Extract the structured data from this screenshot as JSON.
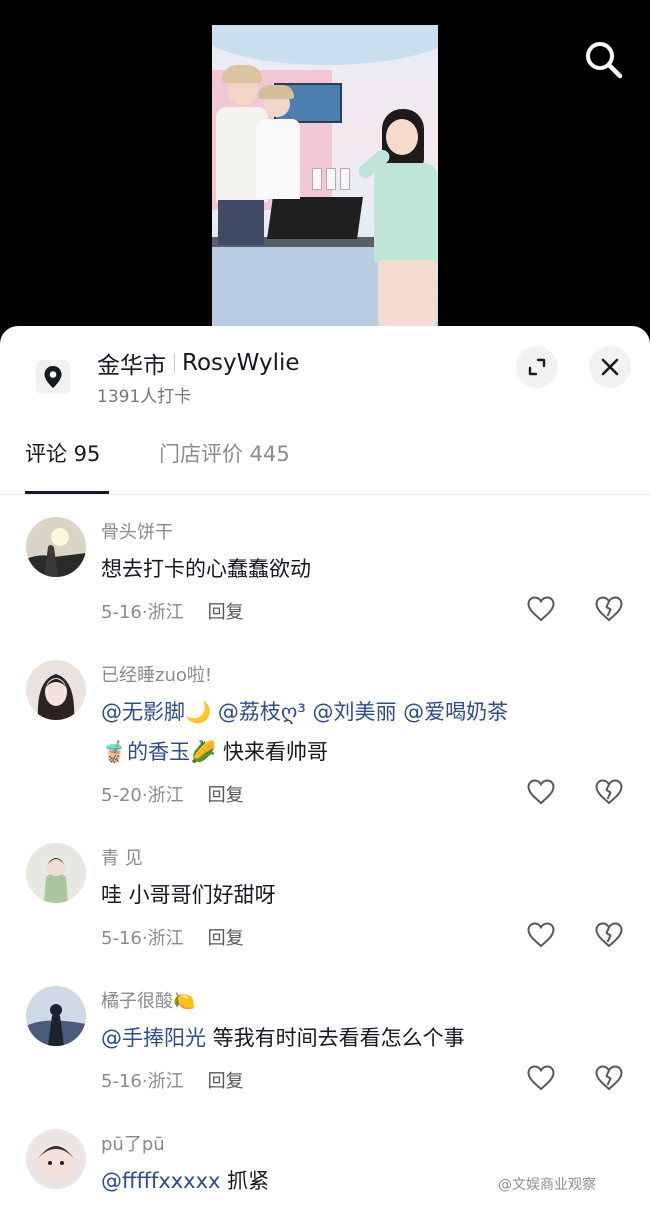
{
  "video": {
    "search_icon": "search-icon"
  },
  "location": {
    "icon": "location-pin-icon",
    "city": "金华市",
    "store": "RosyWylie",
    "checkins": "1391人打卡"
  },
  "tabs": [
    {
      "label": "评论 95",
      "active": true
    },
    {
      "label": "门店评价 445",
      "active": false
    }
  ],
  "comments": [
    {
      "user": "骨头饼干",
      "text_parts": [
        {
          "t": "想去打卡的心蠢蠢欲动",
          "m": false
        }
      ],
      "date": "5-16",
      "region": "浙江",
      "reply": "回复"
    },
    {
      "user": "已经睡zuo啦!",
      "line1": [
        {
          "t": "@无影脚🌙",
          "m": true
        },
        {
          "t": " ",
          "m": false
        },
        {
          "t": "@荔枝ღ³",
          "m": true
        },
        {
          "t": " ",
          "m": false
        },
        {
          "t": "@刘美丽",
          "m": true
        },
        {
          "t": " ",
          "m": false
        },
        {
          "t": "@爱喝奶茶",
          "m": true
        }
      ],
      "line2": [
        {
          "t": "🧋的香玉🌽",
          "m": true
        },
        {
          "t": " 快来看帅哥",
          "m": false
        }
      ],
      "date": "5-20",
      "region": "浙江",
      "reply": "回复"
    },
    {
      "user": "青 见",
      "text_parts": [
        {
          "t": "哇 小哥哥们好甜呀",
          "m": false
        }
      ],
      "date": "5-16",
      "region": "浙江",
      "reply": "回复"
    },
    {
      "user": "橘子很酸🍋",
      "text_parts": [
        {
          "t": "@手捧阳光",
          "m": true
        },
        {
          "t": " 等我有时间去看看怎么个事",
          "m": false
        }
      ],
      "date": "5-16",
      "region": "浙江",
      "reply": "回复"
    },
    {
      "user": "pū了pū",
      "text_parts": [
        {
          "t": "@fffffxxxxx",
          "m": true
        },
        {
          "t": " 抓紧",
          "m": false
        }
      ]
    }
  ],
  "watermark": "@文娱商业观察",
  "colors": {
    "mention": "#2c4c8a",
    "muted": "#8a8b91",
    "text": "#161823"
  }
}
